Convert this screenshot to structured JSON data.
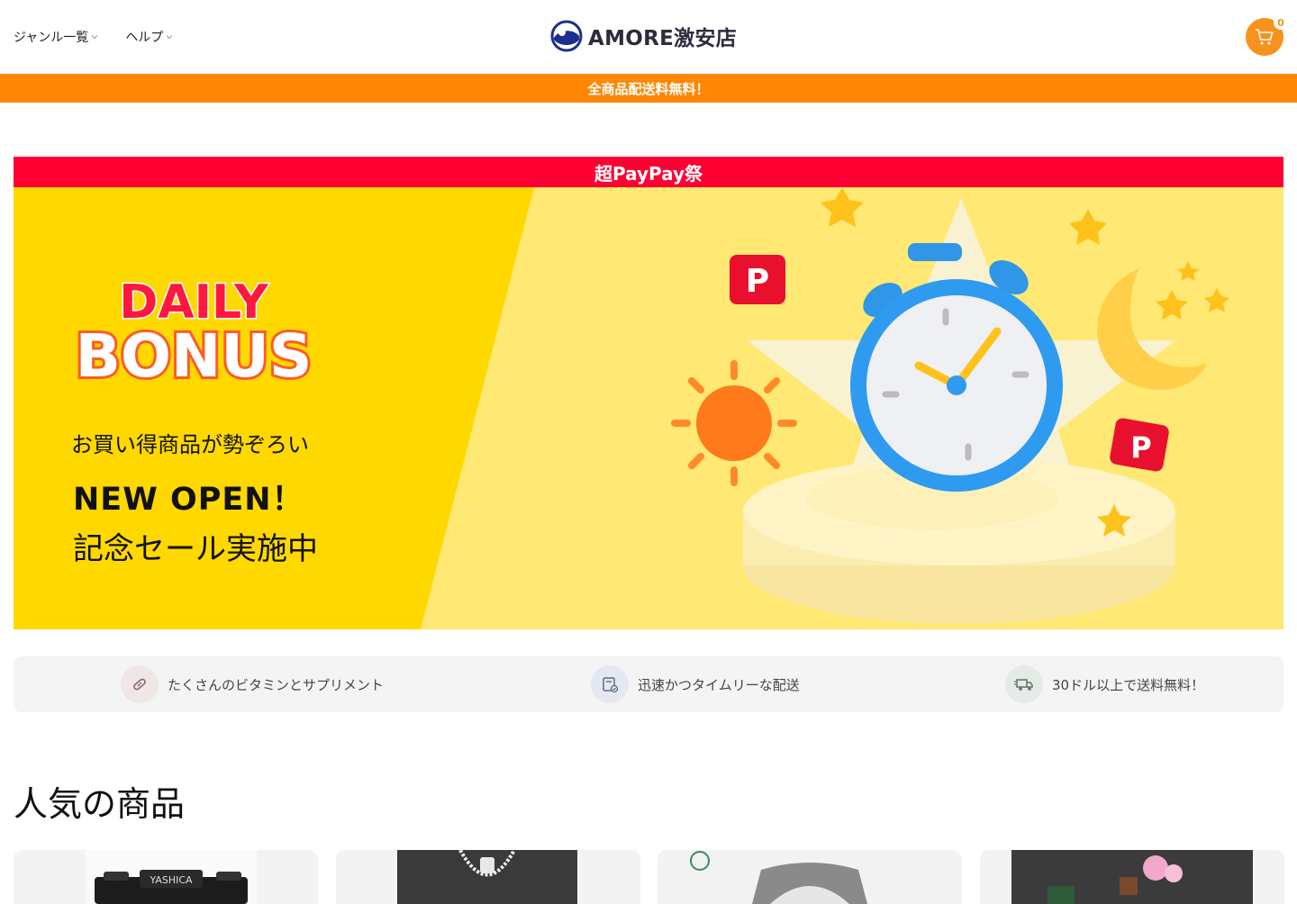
{
  "header": {
    "nav": [
      {
        "label": "ジャンル一覧"
      },
      {
        "label": "ヘルプ"
      }
    ],
    "brand": "AMORE激安店",
    "cart_count": "0"
  },
  "announcement": "全商品配送料無料！",
  "banner": {
    "top_label": "超PayPay祭",
    "logo_line1": "DAILY",
    "logo_line2": "BONUS",
    "line1": "お買い得商品が勢ぞろい",
    "line2": "NEW OPEN！",
    "line3": "記念セール実施中"
  },
  "features": [
    {
      "label": "たくさんのビタミンとサプリメント",
      "icon": "pill-icon"
    },
    {
      "label": "迅速かつタイムリーな配送",
      "icon": "delivery-box-icon"
    },
    {
      "label": "30ドル以上で送料無料！",
      "icon": "truck-icon"
    }
  ],
  "section": {
    "title": "人気の商品"
  },
  "products": [
    {
      "name": "camera",
      "brand": "YASHICA"
    },
    {
      "name": "pearl-necklace"
    },
    {
      "name": "wristwatch"
    },
    {
      "name": "bonsai-model"
    }
  ],
  "colors": {
    "accent": "#ff8705",
    "banner_red": "#ff0033",
    "banner_yellow": "#ffd800"
  }
}
